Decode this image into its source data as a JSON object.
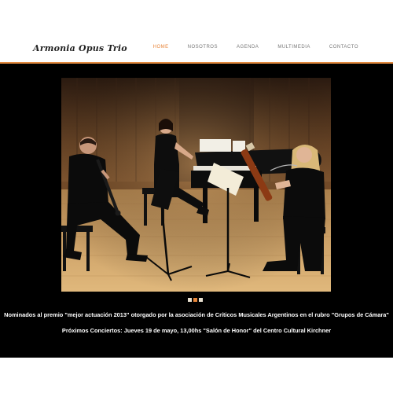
{
  "site": {
    "logo": "Armonia Opus Trio"
  },
  "nav": {
    "items": [
      {
        "label": "HOME",
        "active": true
      },
      {
        "label": "NOSOTROS",
        "active": false
      },
      {
        "label": "AGENDA",
        "active": false
      },
      {
        "label": "MULTIMEDIA",
        "active": false
      },
      {
        "label": "CONTACTO",
        "active": false
      }
    ]
  },
  "slider": {
    "image": "trio-performing-clarinet-piano-bassoon",
    "dots": [
      {
        "active": true
      },
      {
        "active": false
      },
      {
        "active": false
      }
    ]
  },
  "news": {
    "line1": "Nominados al premio \"mejor actuación 2013\" otorgado por la asociación de Críticos Musicales Argentinos en el rubro \"Grupos de Cámara\"",
    "line2": "Próximos Conciertos: Jueves 19 de mayo, 13,00hs \"Salón de Honor\" del Centro Cultural Kirchner"
  },
  "colors": {
    "accent": "#e8863a",
    "hero_bg": "#000000",
    "text_light": "#ffffff"
  }
}
